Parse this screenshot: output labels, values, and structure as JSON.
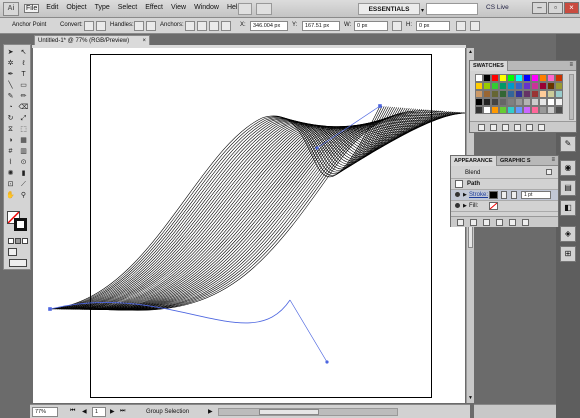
{
  "app": {
    "logo": "Ai"
  },
  "menubar": {
    "items": [
      "File",
      "Edit",
      "Object",
      "Type",
      "Select",
      "Effect",
      "View",
      "Window",
      "Help"
    ],
    "workspace": "ESSENTIALS",
    "cslive": "CS Live"
  },
  "control": {
    "mode": "Anchor Point",
    "convert": "Convert:",
    "handles": "Handles:",
    "anchors": "Anchors:",
    "x_label": "X:",
    "x_value": "346.004 px",
    "y_label": "Y:",
    "y_value": "167.51 px",
    "w_label": "W:",
    "w_value": "0 px",
    "h_label": "H:",
    "h_value": "0 px"
  },
  "document": {
    "tab_title": "Untitled-1* @ 77% (RGB/Preview)",
    "close": "×"
  },
  "swatches": {
    "tab": "SWATCHES",
    "colors": [
      "#ffffff",
      "#000000",
      "#ff0000",
      "#ffff00",
      "#00ff00",
      "#00ffff",
      "#0000ff",
      "#ff00ff",
      "#ff7f00",
      "#ff66cc",
      "#cc3300",
      "#ffcc00",
      "#99cc00",
      "#33cc33",
      "#009966",
      "#0099cc",
      "#3366cc",
      "#6633cc",
      "#cc3399",
      "#990033",
      "#663300",
      "#999933",
      "#cc9966",
      "#996633",
      "#666633",
      "#336633",
      "#336699",
      "#333399",
      "#663366",
      "#993333",
      "#ffcc99",
      "#cccc99",
      "#99cccc",
      "#000000",
      "#222222",
      "#444444",
      "#666666",
      "#808080",
      "#999999",
      "#b3b3b3",
      "#cccccc",
      "#e6e6e6",
      "#ffffff",
      "#f2f2f2",
      "#333333",
      "#ffffff",
      "#ff9900",
      "#66cc33",
      "#33cccc",
      "#6699ff",
      "#cc66ff",
      "#ff6699",
      "#999999",
      "#cccccc",
      "#4d4d4d"
    ]
  },
  "appearance": {
    "tabs": [
      "APPEARANCE",
      "GRAPHIC S"
    ],
    "object": "Blend",
    "path": "Path",
    "stroke_label": "Stroke:",
    "stroke_weight": "1 pt",
    "fill_label": "Fill:"
  },
  "status": {
    "zoom": "77%",
    "page": "1",
    "tool": "Group Selection"
  }
}
